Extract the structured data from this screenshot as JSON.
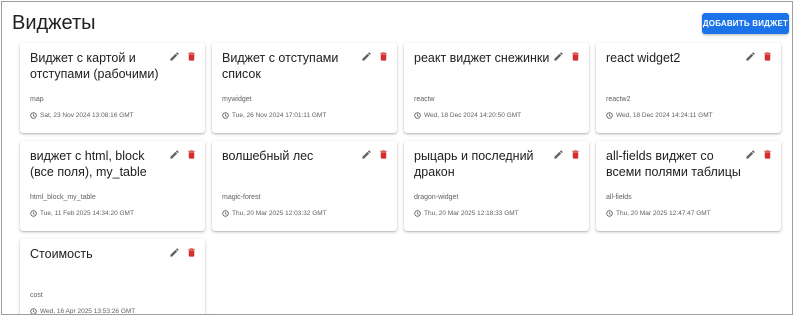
{
  "page": {
    "title": "Виджеты",
    "add_button": "ДОБАВИТЬ ВИДЖЕТ"
  },
  "colors": {
    "accent": "#1a73e8",
    "delete": "#d32f2f",
    "edit": "#616161"
  },
  "icons": {
    "edit": "pencil-icon",
    "delete": "trash-icon",
    "date": "clock-icon"
  },
  "widgets": [
    {
      "title": "Виджет с картой и отступами (рабочими)",
      "slug": "map",
      "date": "Sat, 23 Nov 2024 13:08:16 GMT"
    },
    {
      "title": "Виджет с отступами список",
      "slug": "mywidget",
      "date": "Tue, 26 Nov 2024 17:01:11 GMT"
    },
    {
      "title": "реакт виджет снежинки",
      "slug": "reactw",
      "date": "Wed, 18 Dec 2024 14:20:50 GMT"
    },
    {
      "title": "react widget2",
      "slug": "reactw2",
      "date": "Wed, 18 Dec 2024 14:24:11 GMT"
    },
    {
      "title": "виджет с html, block (все поля), my_table",
      "slug": "html_block_my_table",
      "date": "Tue, 11 Feb 2025 14:34:20 GMT"
    },
    {
      "title": "волшебный лес",
      "slug": "magic-forest",
      "date": "Thu, 20 Mar 2025 12:03:32 GMT"
    },
    {
      "title": "рыцарь и последний дракон",
      "slug": "dragon-widget",
      "date": "Thu, 20 Mar 2025 12:18:33 GMT"
    },
    {
      "title": "all-fields виджет со всеми полями таблицы",
      "slug": "all-fields",
      "date": "Thu, 20 Mar 2025 12:47:47 GMT"
    },
    {
      "title": "Стоимость",
      "slug": "cost",
      "date": "Wed, 16 Apr 2025 13:53:26 GMT"
    }
  ]
}
